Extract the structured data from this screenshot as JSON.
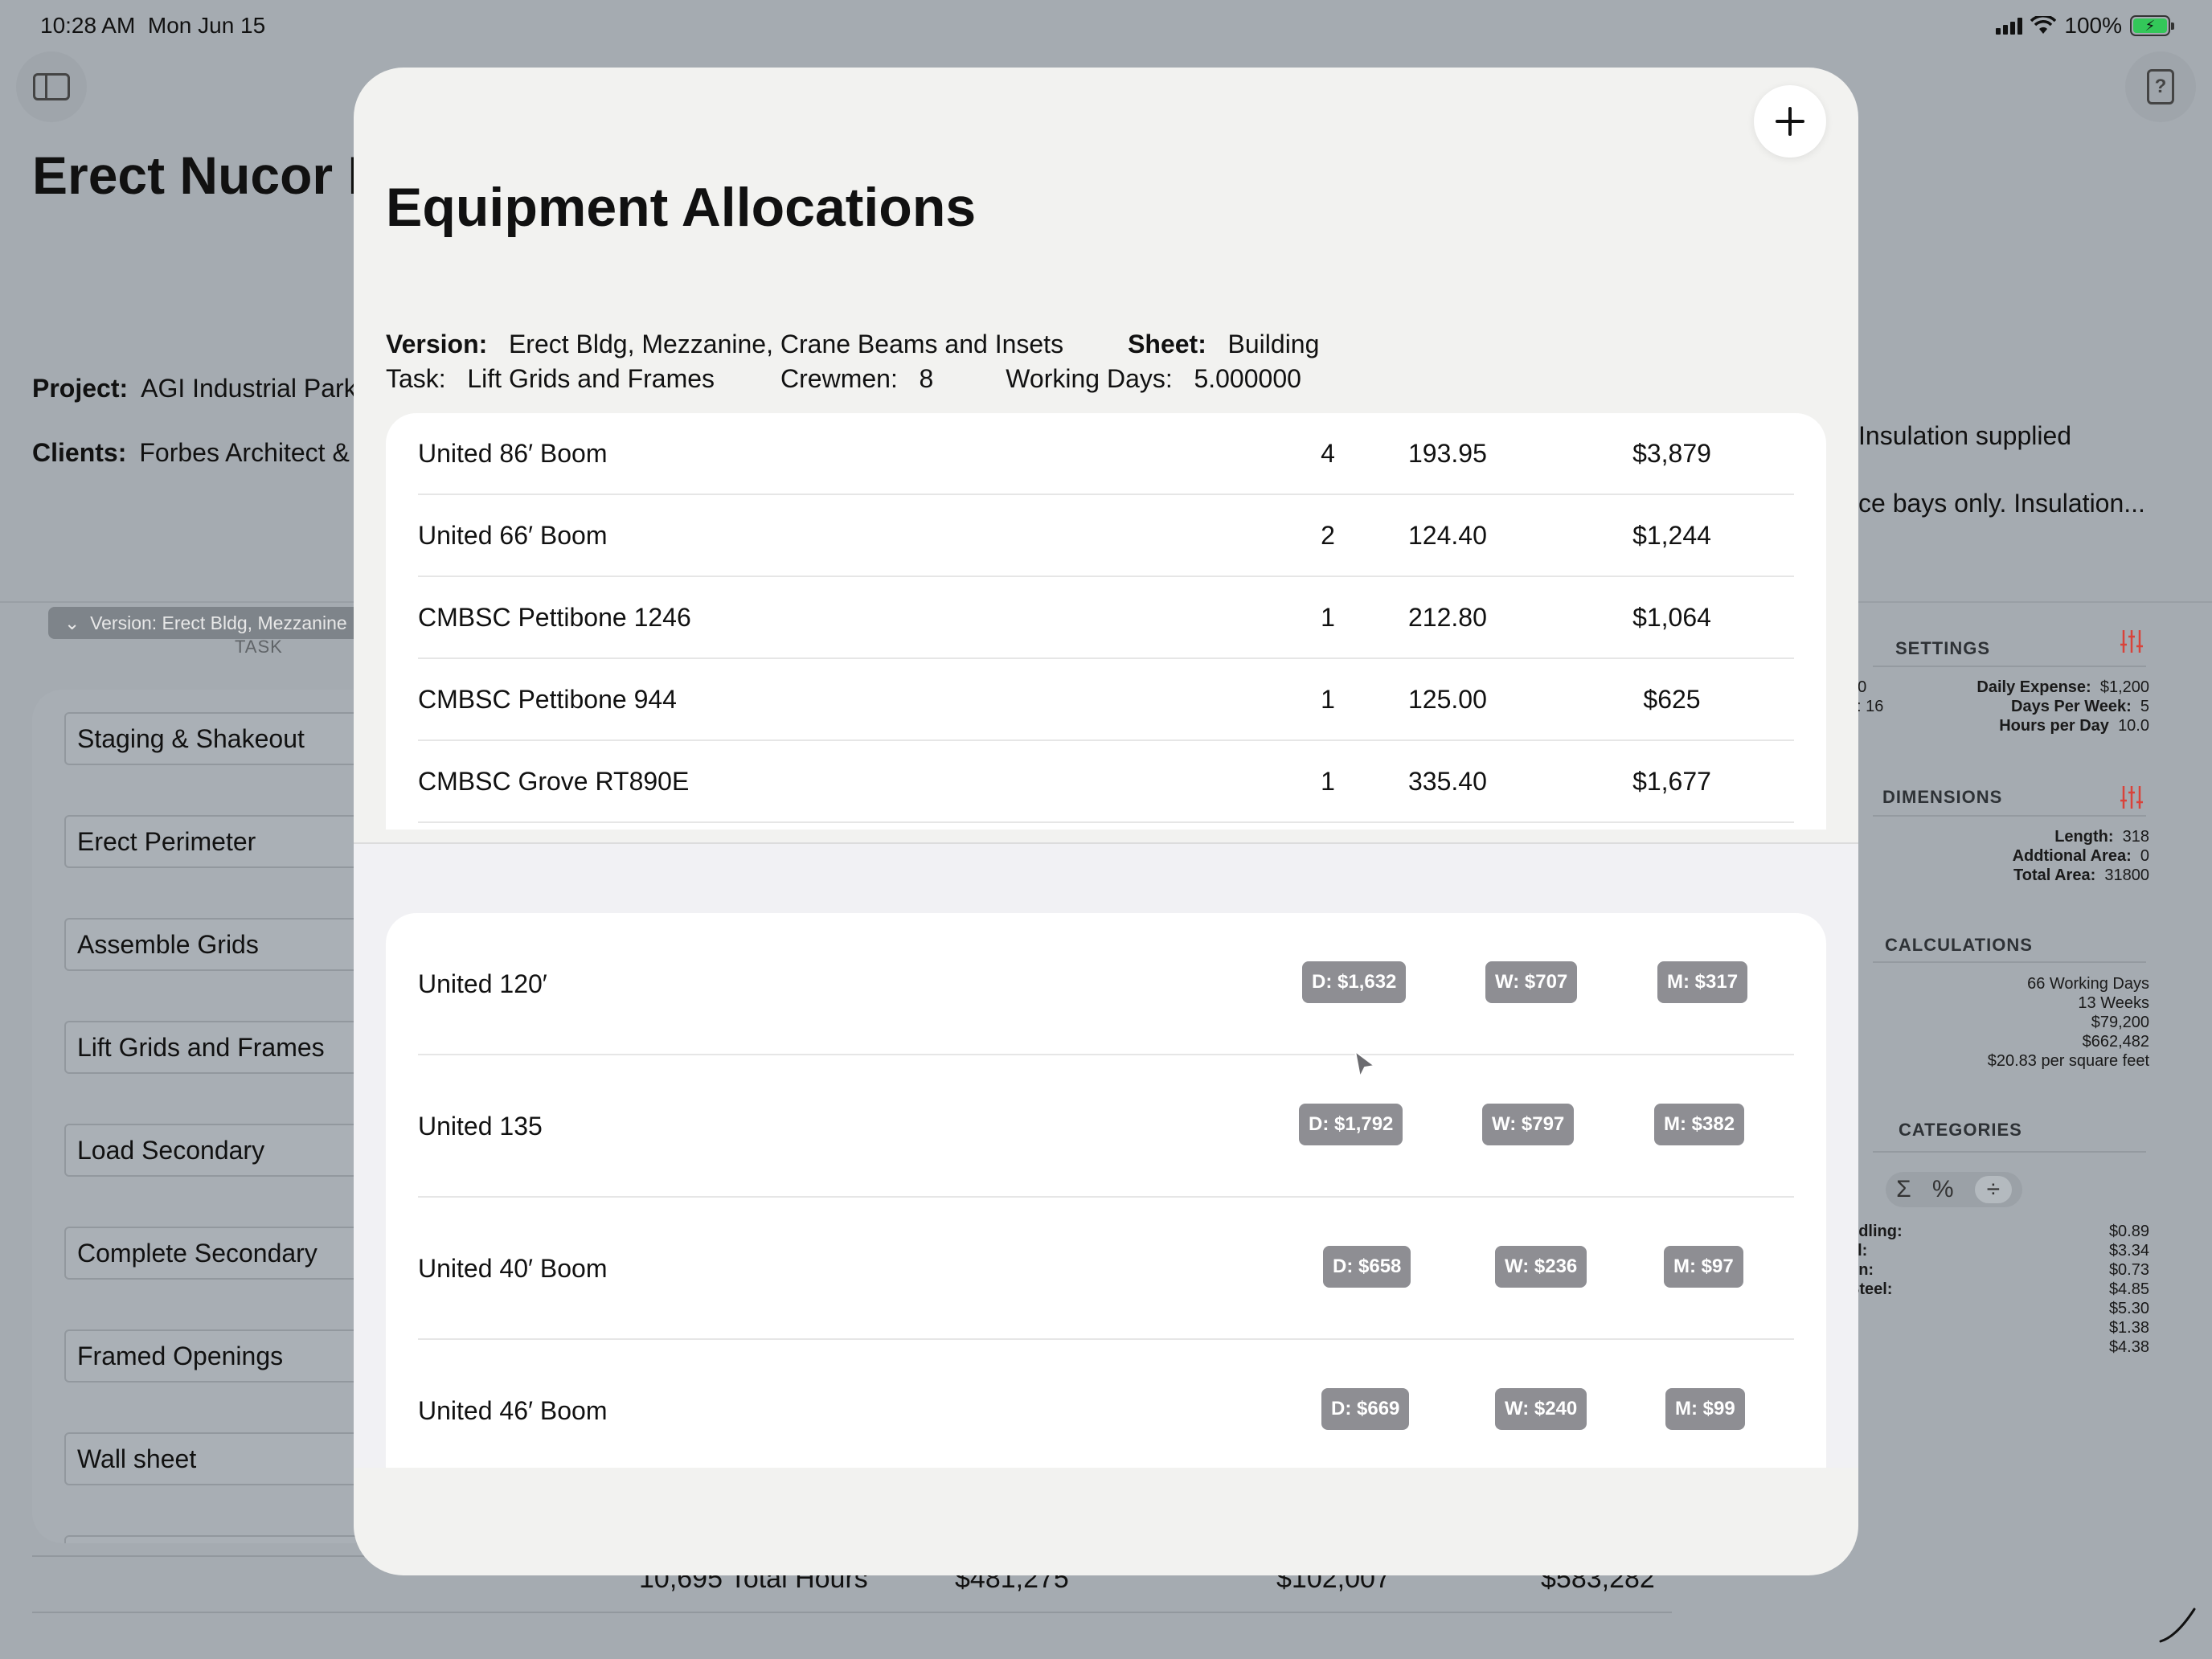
{
  "status": {
    "time": "10:28 AM",
    "date": "Mon Jun 15",
    "battery": "100%"
  },
  "background": {
    "title": "Erect Nucor B",
    "project_label": "Project:",
    "project_value": "AGI Industrial Park",
    "clients_label": "Clients:",
    "clients_value": "Forbes Architect &",
    "version_pill": "Version: Erect Bldg, Mezzanine",
    "task_header": "TASK",
    "tasks": [
      "Staging & Shakeout",
      "Erect Perimeter",
      "Assemble Grids",
      "Lift Grids and Frames",
      "Load Secondary",
      "Complete Secondary",
      "Framed Openings",
      "Wall sheet"
    ],
    "totals": {
      "hours": "10,695 Total Hours",
      "labor": "$481,275",
      "equipment": "$102,007",
      "total": "$583,282"
    },
    "notes_line1": "Insulation supplied",
    "notes_line2": "ce bays only. Insulation...",
    "settings": {
      "title": "SETTINGS",
      "left_values": [
        "00",
        "s:  16"
      ],
      "daily_expense_label": "Daily Expense:",
      "daily_expense": "$1,200",
      "days_per_week_label": "Days Per Week:",
      "days_per_week": "5",
      "hours_per_day_label": "Hours per Day",
      "hours_per_day": "10.0"
    },
    "dimensions": {
      "title": "DIMENSIONS",
      "length_label": "Length:",
      "length": "318",
      "additional_area_label": "Addtional Area:",
      "additional_area": "0",
      "total_area_label": "Total Area:",
      "total_area": "31800"
    },
    "calculations": {
      "title": "CALCULATIONS",
      "values": [
        "66 Working Days",
        "13 Weeks",
        "$79,200",
        "$662,482",
        "$20.83 per square feet"
      ]
    },
    "categories": {
      "title": "CATEGORIES",
      "segments": [
        "Σ",
        "%",
        "÷"
      ],
      "left_labels": [
        "ndling:",
        "el:",
        "on:",
        "",
        "Steel:",
        "",
        ""
      ],
      "values": [
        "$0.89",
        "$3.34",
        "$0.73",
        "$4.85",
        "$5.30",
        "$1.38",
        "$4.38"
      ]
    }
  },
  "modal": {
    "title": "Equipment Allocations",
    "version_label": "Version:",
    "version_value": "Erect Bldg, Mezzanine, Crane Beams and Insets",
    "sheet_label": "Sheet:",
    "sheet_value": "Building",
    "task_label": "Task:",
    "task_value": "Lift Grids and Frames",
    "crewmen_label": "Crewmen:",
    "crewmen_value": "8",
    "working_days_label": "Working Days:",
    "working_days_value": "5.000000",
    "allocations": [
      {
        "name": "United 86′ Boom",
        "qty": "4",
        "rate": "193.95",
        "total": "$3,879"
      },
      {
        "name": "United 66′ Boom",
        "qty": "2",
        "rate": "124.40",
        "total": "$1,244"
      },
      {
        "name": "CMBSC Pettibone 1246",
        "qty": "1",
        "rate": "212.80",
        "total": "$1,064"
      },
      {
        "name": "CMBSC Pettibone 944",
        "qty": "1",
        "rate": "125.00",
        "total": "$625"
      },
      {
        "name": "CMBSC Grove RT890E",
        "qty": "1",
        "rate": "335.40",
        "total": "$1,677"
      }
    ],
    "rates": [
      {
        "name": "United 120′",
        "daily": "D: $1,632",
        "weekly": "W: $707",
        "monthly": "M: $317"
      },
      {
        "name": "United 135",
        "daily": "D: $1,792",
        "weekly": "W: $797",
        "monthly": "M: $382"
      },
      {
        "name": "United 40′ Boom",
        "daily": "D: $658",
        "weekly": "W: $236",
        "monthly": "M: $97"
      },
      {
        "name": "United 46′ Boom",
        "daily": "D: $669",
        "weekly": "W: $240",
        "monthly": "M: $99"
      }
    ]
  },
  "colors": {
    "badge": "#8e8e93",
    "accent_red": "#d9433a",
    "battery_green": "#33c759"
  }
}
